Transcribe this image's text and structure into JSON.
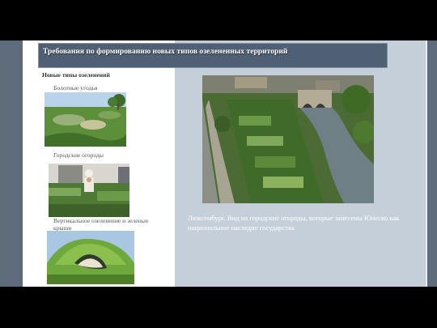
{
  "slide": {
    "title": "Требования по формированию новых типов озелененных территорий",
    "subtitle": "Новые типы озеленений",
    "bullet_glyph": "",
    "items": [
      {
        "label": "Болотные угодья"
      },
      {
        "label": "Городские огороды"
      },
      {
        "label": "Вертикальное озеленение и зеленые крыши"
      }
    ],
    "caption": "Люксембург. Вид на городские огороды, которые занесены Юнеско как национальное наследие государства"
  },
  "colors": {
    "background": "#000000",
    "slide_frame": "#5d6b7b",
    "left_panel": "#ffffff",
    "right_panel": "#c5cfda",
    "title_bar": "#4f5f74"
  }
}
